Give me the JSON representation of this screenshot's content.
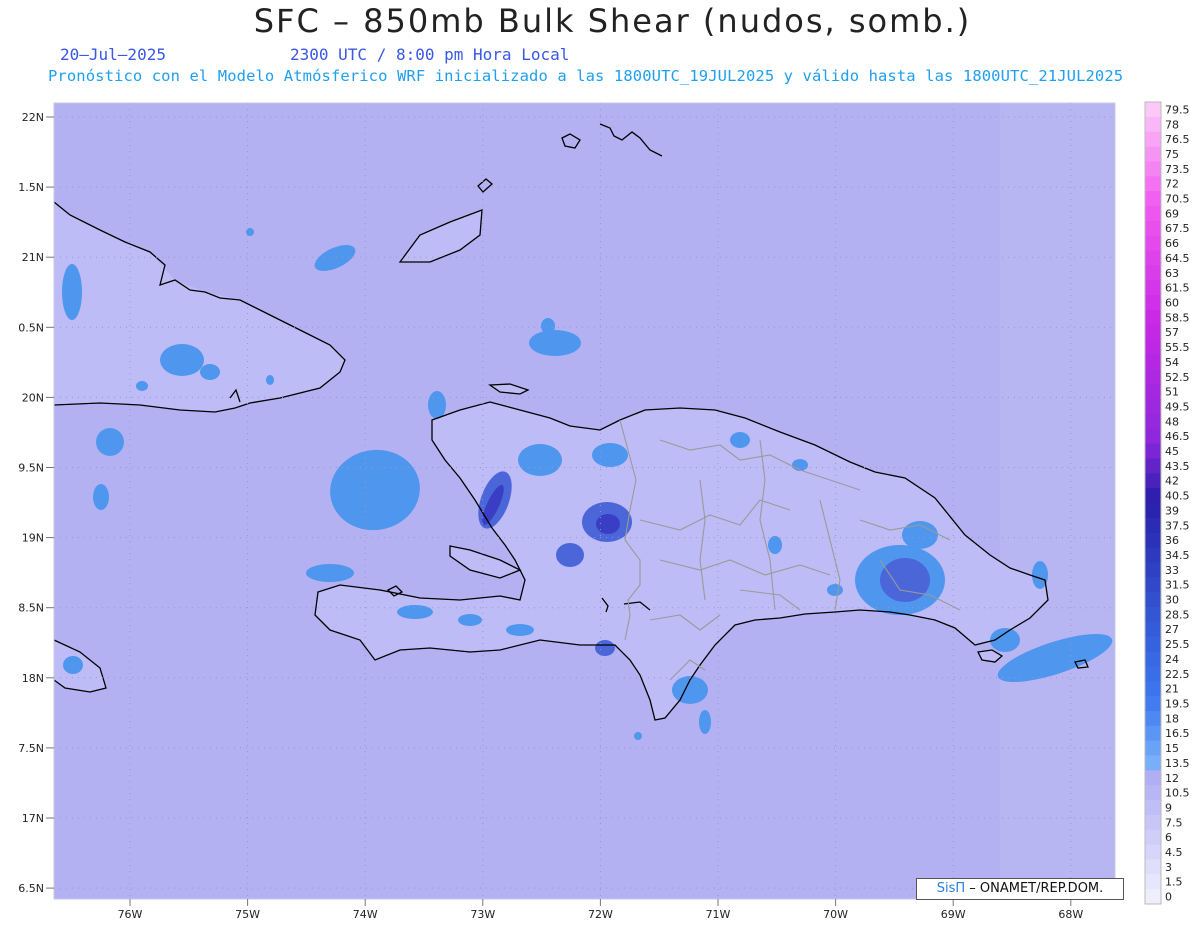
{
  "title": "SFC – 850mb Bulk Shear (nudos, somb.)",
  "date": "20–Jul–2025",
  "valid_time": "2300 UTC / 8:00 pm Hora Local",
  "model_info": "Pronóstico con el Modelo Atmósferico WRF inicializado a las 1800UTC_19JUL2025 y válido hasta las  1800UTC_21JUL2025",
  "credit": {
    "brand": "SisΠ",
    "org": " – ONAMET/REP.DOM."
  },
  "lat_labels": [
    "22N",
    "1.5N",
    "21N",
    "0.5N",
    "20N",
    "9.5N",
    "19N",
    "8.5N",
    "18N",
    "7.5N",
    "17N",
    "6.5N"
  ],
  "lon_labels": [
    "76W",
    "75W",
    "74W",
    "73W",
    "72W",
    "71W",
    "70W",
    "69W",
    "68W"
  ],
  "colorbar_labels": [
    "79.5",
    "78",
    "76.5",
    "75",
    "73.5",
    "72",
    "70.5",
    "69",
    "67.5",
    "66",
    "64.5",
    "63",
    "61.5",
    "60",
    "58.5",
    "57",
    "55.5",
    "54",
    "52.5",
    "51",
    "49.5",
    "48",
    "46.5",
    "45",
    "43.5",
    "42",
    "40.5",
    "39",
    "37.5",
    "36",
    "34.5",
    "33",
    "31.5",
    "30",
    "28.5",
    "27",
    "25.5",
    "24",
    "22.5",
    "21",
    "19.5",
    "18",
    "16.5",
    "15",
    "13.5",
    "12",
    "10.5",
    "9",
    "7.5",
    "6",
    "4.5",
    "3",
    "1.5",
    "0"
  ],
  "colors": {
    "ocean": "#b3b1f2",
    "land": "#bdbcf6",
    "shade_15": "#4f96ee",
    "shade_20": "#4b66d9",
    "shade_30": "#3a3ec4",
    "coast": "#000000",
    "borders": "#9a9a9a"
  }
}
